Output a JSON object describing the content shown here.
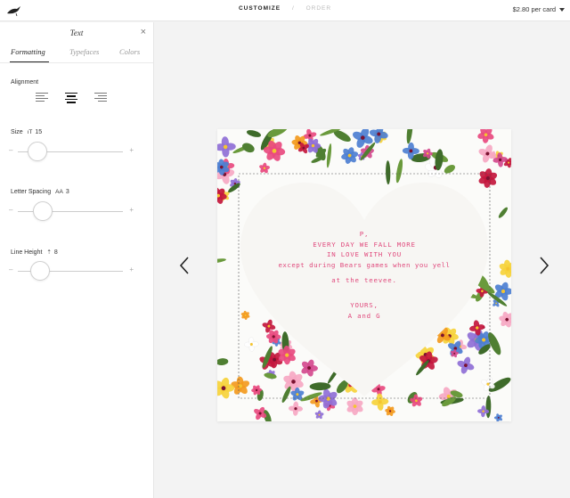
{
  "topbar": {
    "steps": [
      "CUSTOMIZE",
      "/",
      "ORDER"
    ],
    "price": "$2.80 per card"
  },
  "sidebar": {
    "title": "Text",
    "tabs": [
      "Formatting",
      "Typefaces",
      "Colors"
    ],
    "alignment_label": "Alignment",
    "size_label": "Size",
    "size_value": "15",
    "letter_spacing_label": "Letter Spacing",
    "letter_spacing_value": "3",
    "line_height_label": "Line Height",
    "line_height_value": "8"
  },
  "card": {
    "lines": [
      "P,",
      "EVERY DAY WE FALL MORE",
      "IN LOVE WITH YOU",
      "except during Bears games when you yell",
      "at the teevee.",
      "YOURS,",
      "A and G"
    ]
  },
  "colors": {
    "card_text": "#e0497c"
  }
}
